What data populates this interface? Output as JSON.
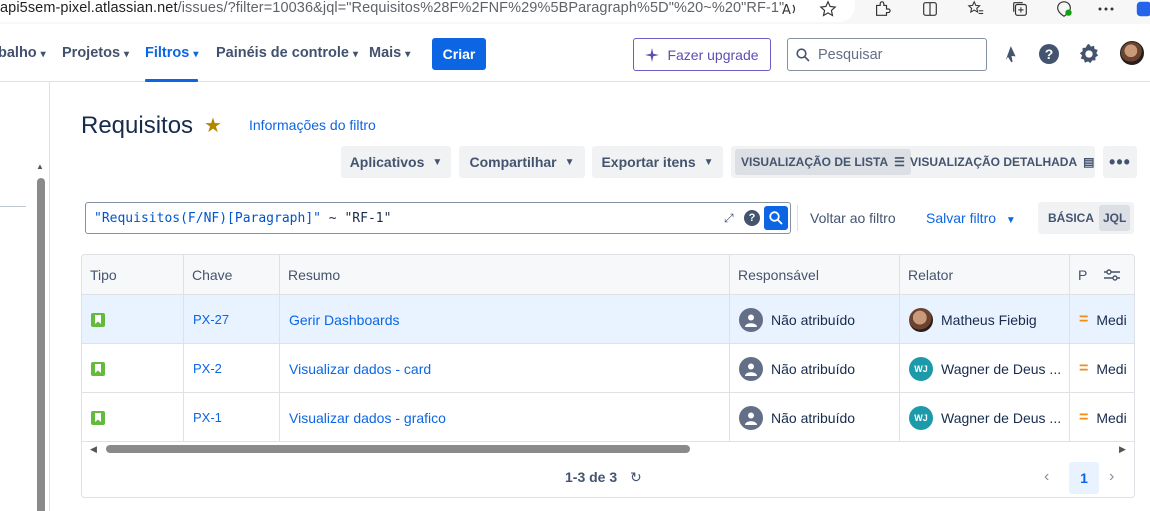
{
  "browser": {
    "url_host": "api5sem-pixel.atlassian.net",
    "url_rest": "/issues/?filter=10036&jql=\"Requisitos%28F%2FNF%29%5BParagraph%5D\"%20~%20\"RF-1\""
  },
  "nav": {
    "items": [
      {
        "label": "balho"
      },
      {
        "label": "Projetos"
      },
      {
        "label": "Filtros"
      },
      {
        "label": "Painéis de controle"
      },
      {
        "label": "Mais"
      }
    ],
    "create_label": "Criar",
    "upgrade_label": "Fazer upgrade",
    "search_placeholder": "Pesquisar"
  },
  "page": {
    "title": "Requisitos",
    "filter_info": "Informações do filtro"
  },
  "toolbar": {
    "apps": "Aplicativos",
    "share": "Compartilhar",
    "export": "Exportar itens",
    "list_view": "VISUALIZAÇÃO DE LISTA",
    "detail_view": "VISUALIZAÇÃO DETALHADA",
    "more": "•••"
  },
  "jql": {
    "query_field": "\"Requisitos(F/NF)[Paragraph]\"",
    "query_op": " ~ ",
    "query_value": "\"RF-1\"",
    "back_to_filter": "Voltar ao filtro",
    "save_filter": "Salvar filtro",
    "basic": "BÁSICA",
    "jql": "JQL"
  },
  "table": {
    "headers": [
      "Tipo",
      "Chave",
      "Resumo",
      "Responsável",
      "Relator",
      "P"
    ],
    "rows": [
      {
        "key": "PX-27",
        "summary": "Gerir Dashboards",
        "assignee": "Não atribuído",
        "reporter": "Matheus Fiebig",
        "reporter_initials": "",
        "priority": "Medi"
      },
      {
        "key": "PX-2",
        "summary": "Visualizar dados - card",
        "assignee": "Não atribuído",
        "reporter": "Wagner de Deus ...",
        "reporter_initials": "WJ",
        "priority": "Medi"
      },
      {
        "key": "PX-1",
        "summary": "Visualizar dados - grafico",
        "assignee": "Não atribuído",
        "reporter": "Wagner de Deus ...",
        "reporter_initials": "WJ",
        "priority": "Medi"
      }
    ],
    "count": "1-3 de 3",
    "page": "1"
  },
  "colors": {
    "accent": "#0c66e4",
    "story": "#63ba3c",
    "priority_medium": "#f18d13",
    "upgrade": "#5e4db2"
  }
}
